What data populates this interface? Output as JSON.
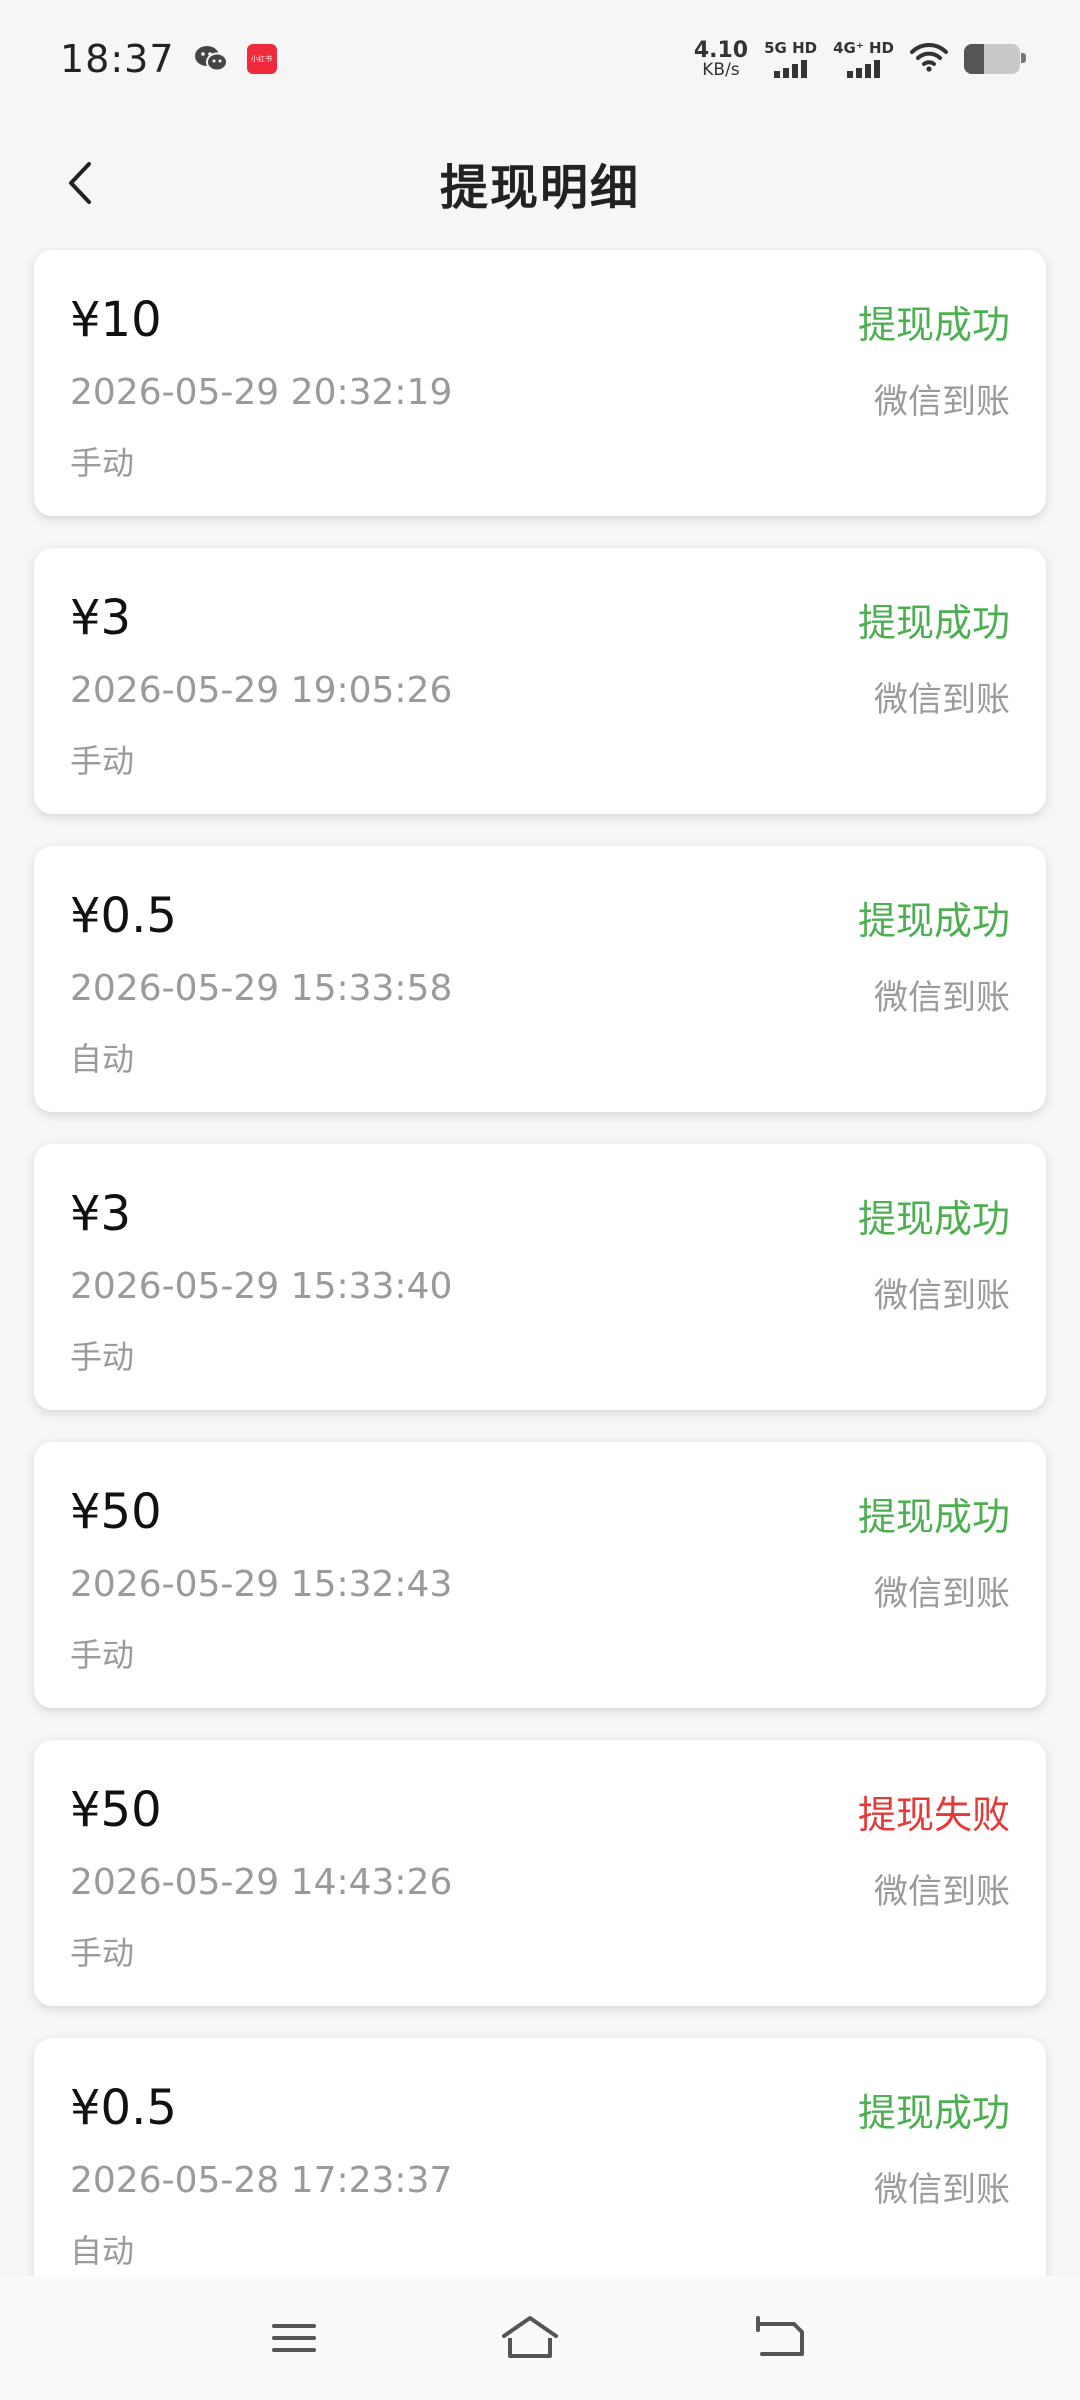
{
  "status_bar": {
    "time": "18:37",
    "app_badge_text": "小红书",
    "net_speed_value": "4.10",
    "net_speed_unit": "KB/s",
    "sim1_label": "5G HD",
    "sim2_label": "4G⁺ HD",
    "battery_level": 0.35,
    "icons": [
      "wechat-icon",
      "wifi-icon",
      "battery-icon"
    ]
  },
  "header": {
    "title": "提现明细",
    "back_icon": "chevron-left-icon"
  },
  "colors": {
    "success": "#4caf50",
    "failure": "#e53935",
    "muted": "#9a9a9a"
  },
  "records": [
    {
      "amount": "¥10",
      "status": "提现成功",
      "status_type": "success",
      "datetime": "2026-05-29 20:32:19",
      "channel": "微信到账",
      "mode": "手动"
    },
    {
      "amount": "¥3",
      "status": "提现成功",
      "status_type": "success",
      "datetime": "2026-05-29 19:05:26",
      "channel": "微信到账",
      "mode": "手动"
    },
    {
      "amount": "¥0.5",
      "status": "提现成功",
      "status_type": "success",
      "datetime": "2026-05-29 15:33:58",
      "channel": "微信到账",
      "mode": "自动"
    },
    {
      "amount": "¥3",
      "status": "提现成功",
      "status_type": "success",
      "datetime": "2026-05-29 15:33:40",
      "channel": "微信到账",
      "mode": "手动"
    },
    {
      "amount": "¥50",
      "status": "提现成功",
      "status_type": "success",
      "datetime": "2026-05-29 15:32:43",
      "channel": "微信到账",
      "mode": "手动"
    },
    {
      "amount": "¥50",
      "status": "提现失败",
      "status_type": "failure",
      "datetime": "2026-05-29 14:43:26",
      "channel": "微信到账",
      "mode": "手动"
    },
    {
      "amount": "¥0.5",
      "status": "提现成功",
      "status_type": "success",
      "datetime": "2026-05-28 17:23:37",
      "channel": "微信到账",
      "mode": "自动"
    }
  ],
  "nav_bar": {
    "icons": [
      "menu-icon",
      "home-icon",
      "back-nav-icon"
    ]
  }
}
